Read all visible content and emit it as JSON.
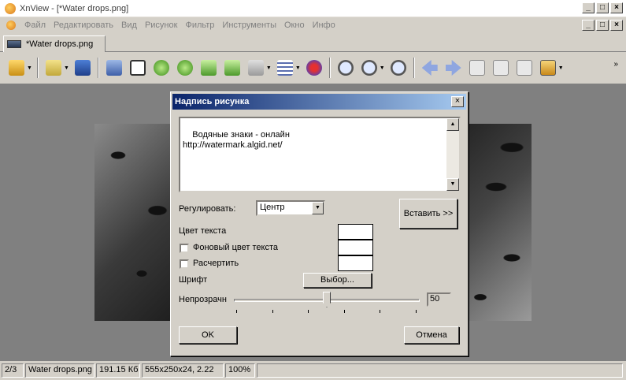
{
  "window": {
    "title": "XnView - [*Water drops.png]"
  },
  "menu": [
    "Файл",
    "Редактировать",
    "Вид",
    "Рисунок",
    "Фильтр",
    "Инструменты",
    "Окно",
    "Инфо"
  ],
  "tab": {
    "label": "*Water drops.png"
  },
  "toolbar": {
    "icons": [
      "browser-icon",
      "open-folder-icon",
      "save-icon",
      "undo-icon",
      "crop-icon",
      "rotate-left-icon",
      "rotate-right-icon",
      "export-icon",
      "convert-icon",
      "batch-icon",
      "adjust-icon",
      "redeye-icon",
      "zoom-in-icon",
      "zoom-icon",
      "zoom-out-icon",
      "previous-icon",
      "next-icon",
      "first-icon",
      "last-icon",
      "fullscreen-icon",
      "slideshow-icon"
    ]
  },
  "dialog": {
    "title": "Надпись рисунка",
    "text": "Водяные знаки - онлайн\nhttp://watermark.algid.net/",
    "align_label": "Регулировать:",
    "align_value": "Центр",
    "insert_button": "Вставить >>",
    "text_color_label": "Цвет текста",
    "bg_color_label": "Фоновый цвет текста",
    "outline_label": "Расчертить",
    "font_label": "Шрифт",
    "font_button": "Выбор...",
    "opacity_label": "Непрозрачн",
    "opacity_value": "50",
    "ok_button": "OK",
    "cancel_button": "Отмена"
  },
  "status": {
    "index": "2/3",
    "filename": "Water drops.png",
    "size": "191.15 Кб",
    "dims": "555x250x24, 2.22",
    "zoom": "100%"
  }
}
